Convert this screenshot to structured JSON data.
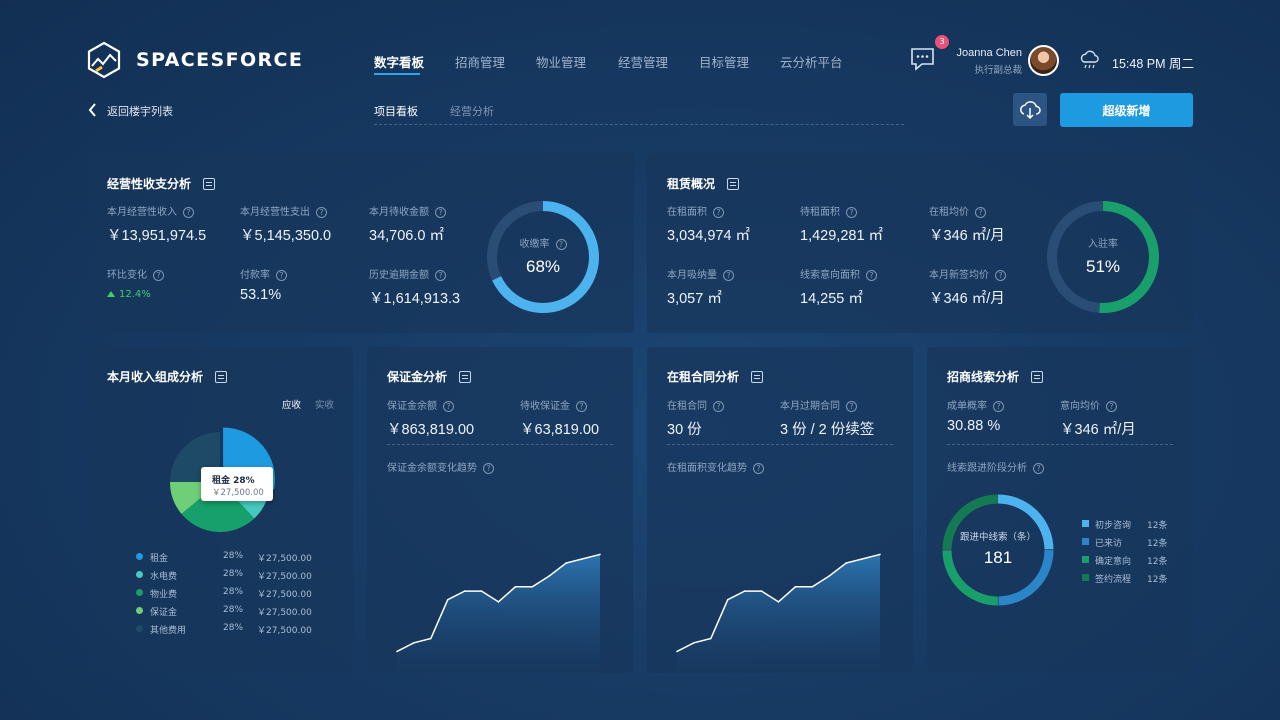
{
  "brand": {
    "name": "SPACESFORCE"
  },
  "nav": {
    "items": [
      "数字看板",
      "招商管理",
      "物业管理",
      "经营管理",
      "目标管理",
      "云分析平台"
    ],
    "active_index": 0
  },
  "header": {
    "notification_count": "3",
    "user_name": "Joanna Chen",
    "user_role": "执行副总裁",
    "time": "15:48 PM 周二"
  },
  "subnav": {
    "back_label": "返回楼宇列表",
    "tabs": [
      "项目看板",
      "经营分析"
    ],
    "upload_icon": "cloud-upload-icon",
    "primary_button": "超级新增"
  },
  "colors": {
    "accent": "#1e9be0",
    "ring_blue": "#4db3ee",
    "ring_green": "#19a06a",
    "up": "#3fcf6a"
  },
  "revenue": {
    "title": "经营性收支分析",
    "items": [
      {
        "label": "本月经营性收入",
        "value": "￥13,951,974.5"
      },
      {
        "label": "本月经营性支出",
        "value": "￥5,145,350.0"
      },
      {
        "label": "本月待收金额",
        "value": "34,706.0 ㎡"
      },
      {
        "label": "环比变化",
        "value": "12.4%"
      },
      {
        "label": "付款率",
        "value": "53.1%"
      },
      {
        "label": "历史逾期金额",
        "value": "￥1,614,913.3"
      }
    ],
    "gauge": {
      "label": "收缴率",
      "value": "68%",
      "fraction": 0.68
    }
  },
  "lease": {
    "title": "租赁概况",
    "items": [
      {
        "label": "在租面积",
        "value": "3,034,974 ㎡"
      },
      {
        "label": "待租面积",
        "value": "1,429,281 ㎡"
      },
      {
        "label": "在租均价",
        "value": "￥346 ㎡/月"
      },
      {
        "label": "本月吸纳量",
        "value": "3,057 ㎡"
      },
      {
        "label": "线索意向面积",
        "value": "14,255 ㎡"
      },
      {
        "label": "本月新签均价",
        "value": "￥346 ㎡/月"
      }
    ],
    "gauge": {
      "label": "入驻率",
      "value": "51%",
      "fraction": 0.51
    }
  },
  "income": {
    "title": "本月收入组成分析",
    "toggle": [
      "应收",
      "实收"
    ],
    "tooltip": {
      "title": "租金 28%",
      "value": "￥27,500.00"
    },
    "rows": [
      {
        "name": "租金",
        "pct": "28%",
        "amount": "￥27,500.00",
        "color": "#1e9be0"
      },
      {
        "name": "水电费",
        "pct": "28%",
        "amount": "￥27,500.00",
        "color": "#48c9c0"
      },
      {
        "name": "物业费",
        "pct": "28%",
        "amount": "￥27,500.00",
        "color": "#17a06b"
      },
      {
        "name": "保证金",
        "pct": "28%",
        "amount": "￥27,500.00",
        "color": "#6fcf78"
      },
      {
        "name": "其他费用",
        "pct": "28%",
        "amount": "￥27,500.00",
        "color": "#1d4a66"
      }
    ],
    "pie": [
      {
        "name": "租金",
        "fraction": 0.28,
        "color": "#1e9be0"
      },
      {
        "name": "水电费",
        "fraction": 0.1,
        "color": "#48c9c0"
      },
      {
        "name": "物业费",
        "fraction": 0.26,
        "color": "#17a06b"
      },
      {
        "name": "保证金",
        "fraction": 0.11,
        "color": "#6fcf78"
      },
      {
        "name": "其他费用",
        "fraction": 0.25,
        "color": "#1d4a66"
      }
    ]
  },
  "deposit": {
    "title": "保证金分析",
    "items": [
      {
        "label": "保证金余额",
        "value": "￥863,819.00"
      },
      {
        "label": "待收保证金",
        "value": "￥63,819.00"
      }
    ],
    "trend_label": "保证金余额变化趋势"
  },
  "contract": {
    "title": "在租合同分析",
    "items": [
      {
        "label": "在租合同",
        "value": "30 份"
      },
      {
        "label": "本月过期合同",
        "value": "3 份 / 2 份续签"
      }
    ],
    "trend_label": "在租面积变化趋势"
  },
  "leads": {
    "title": "招商线索分析",
    "items": [
      {
        "label": "成单概率",
        "value": "30.88 %"
      },
      {
        "label": "意向均价",
        "value": "￥346 ㎡/月"
      }
    ],
    "stage_label": "线索跟进阶段分析",
    "center_label": "跟进中线索（条）",
    "center_value": "181",
    "stages": [
      {
        "name": "初步咨询",
        "count": "12条",
        "color": "#4db3ee"
      },
      {
        "name": "已来访",
        "count": "12条",
        "color": "#2a86c8"
      },
      {
        "name": "确定意向",
        "count": "12条",
        "color": "#19a06a"
      },
      {
        "name": "签约流程",
        "count": "12条",
        "color": "#137a52"
      }
    ]
  },
  "chart_data": [
    {
      "type": "area",
      "title": "保证金余额变化趋势",
      "x": [
        1,
        2,
        3,
        4,
        5,
        6,
        7,
        8,
        9,
        10,
        11,
        12,
        13
      ],
      "y": [
        10,
        14,
        16,
        34,
        38,
        38,
        33,
        40,
        40,
        45,
        51,
        53,
        55
      ],
      "ylim": [
        0,
        100
      ]
    },
    {
      "type": "area",
      "title": "在租面积变化趋势",
      "x": [
        1,
        2,
        3,
        4,
        5,
        6,
        7,
        8,
        9,
        10,
        11,
        12,
        13
      ],
      "y": [
        10,
        14,
        16,
        34,
        38,
        38,
        33,
        40,
        40,
        45,
        51,
        53,
        55
      ],
      "ylim": [
        0,
        100
      ]
    }
  ]
}
